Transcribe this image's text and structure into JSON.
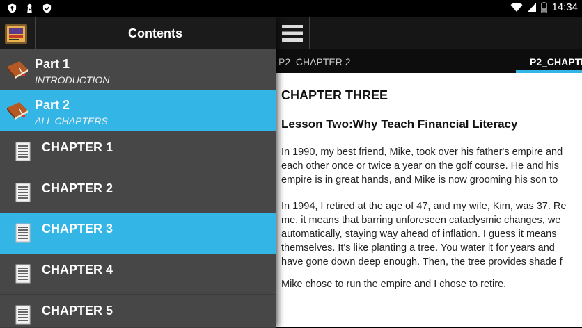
{
  "status_bar": {
    "time": "14:34",
    "left_icons": [
      "shield-icon",
      "keyhole-icon",
      "shield-icon"
    ],
    "right_icons": [
      "wifi-icon",
      "signal-icon",
      "battery-icon"
    ]
  },
  "drawer": {
    "title": "Contents",
    "groups": [
      {
        "label": "Part 1",
        "sublabel": "INTRODUCTION"
      },
      {
        "label": "Part 2",
        "sublabel": "ALL CHAPTERS"
      }
    ],
    "chapters": [
      "CHAPTER 1",
      "CHAPTER 2",
      "CHAPTER 3",
      "CHAPTER 4",
      "CHAPTER 5"
    ],
    "selected_group": "Part 2",
    "selected_chapter": "CHAPTER 3"
  },
  "tabs": [
    {
      "label": "P2_CHAPTER 2",
      "active": false
    },
    {
      "label": "P2_CHAPTE",
      "active": true
    }
  ],
  "content": {
    "heading": "CHAPTER THREE",
    "subheading": "Lesson Two:Why Teach Financial Literacy",
    "paragraphs": [
      [
        "In 1990, my best friend, Mike, took over his father's empire and",
        "each other once or twice a year on the golf course. He and his",
        "empire is in great hands, and Mike is now grooming his son to"
      ],
      [
        "In 1994, I retired at the age of 47, and my wife, Kim, was 37. Re",
        "me, it means that barring unforeseen cataclysmic changes, we",
        "automatically, staying way ahead of inflation. I guess it means",
        "themselves. It's like planting a tree. You water it for years and",
        "have gone down deep enough. Then, the tree provides shade f"
      ],
      [
        "Mike chose to run the empire and I chose to retire."
      ]
    ]
  },
  "colors": {
    "accent": "#33b5e5",
    "drawer_bg": "#474747",
    "header_bg": "#1b1b1b"
  }
}
